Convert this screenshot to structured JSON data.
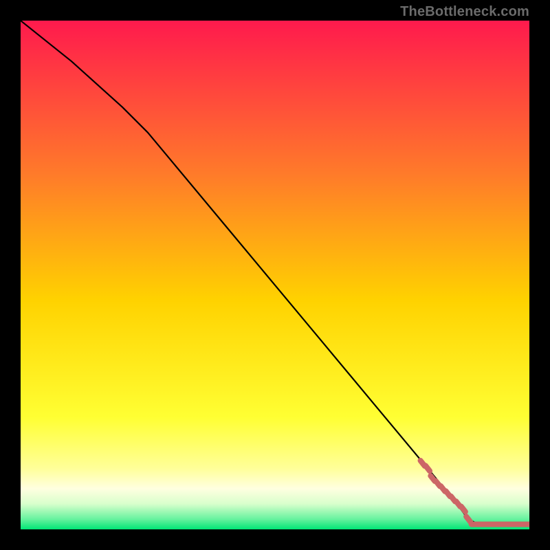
{
  "attribution": "TheBottleneck.com",
  "colors": {
    "bg": "#000000",
    "grad_top": "#ff1a4d",
    "grad_mid_upper": "#ff7a2a",
    "grad_mid": "#ffd200",
    "grad_lower": "#ffff66",
    "grad_pale": "#ffffcc",
    "grad_green": "#00e676",
    "line": "#000000",
    "marker": "#cc6666"
  },
  "chart_data": {
    "type": "line",
    "title": "",
    "xlabel": "",
    "ylabel": "",
    "xlim": [
      0,
      100
    ],
    "ylim": [
      0,
      100
    ],
    "series": [
      {
        "name": "curve",
        "x": [
          0,
          10,
          20,
          25,
          30,
          40,
          50,
          60,
          70,
          80,
          85,
          88,
          90,
          100
        ],
        "y": [
          100,
          92,
          83,
          78,
          72,
          60,
          48,
          36,
          24,
          12,
          6,
          2,
          1,
          1
        ]
      }
    ],
    "markers": {
      "name": "highlight",
      "x": [
        79,
        80,
        81,
        82,
        83,
        84,
        85,
        86,
        87,
        88,
        89,
        90,
        91,
        92,
        93,
        94,
        95,
        96,
        97,
        98,
        99,
        100
      ],
      "y": [
        13,
        12,
        10,
        9,
        8,
        7,
        6,
        5,
        4,
        2,
        1,
        1,
        1,
        1,
        1,
        1,
        1,
        1,
        1,
        1,
        1,
        1
      ]
    },
    "gradient_stops": [
      {
        "pct": 0,
        "color": "#ff1a4d"
      },
      {
        "pct": 30,
        "color": "#ff7a2a"
      },
      {
        "pct": 55,
        "color": "#ffd200"
      },
      {
        "pct": 78,
        "color": "#ffff33"
      },
      {
        "pct": 88,
        "color": "#ffff99"
      },
      {
        "pct": 92,
        "color": "#ffffe0"
      },
      {
        "pct": 95,
        "color": "#d8ffcc"
      },
      {
        "pct": 98,
        "color": "#66f29e"
      },
      {
        "pct": 100,
        "color": "#00e676"
      }
    ]
  }
}
